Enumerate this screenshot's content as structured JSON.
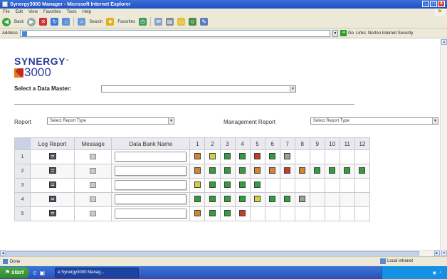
{
  "window": {
    "title": "Synergy3000 Manager - Microsoft Internet Explorer",
    "controls": [
      "_",
      "□",
      "X"
    ]
  },
  "menu": [
    "File",
    "Edit",
    "View",
    "Favorites",
    "Tools",
    "Help"
  ],
  "toolbar": {
    "back": "Back",
    "search": "Search",
    "favorites": "Favorites"
  },
  "address": {
    "label": "Address",
    "url": "",
    "go": "Go",
    "links": "Links",
    "extra": "Norton Internet Security"
  },
  "logo": {
    "word": "SYNERGY",
    "tm": "™",
    "number": "3000"
  },
  "data_master": {
    "label": "Select a Data Master:",
    "value": ""
  },
  "report": {
    "label": "Report",
    "value": "Select Report Type"
  },
  "management_report": {
    "label": "Management Report",
    "value": "Select Report Type"
  },
  "grid": {
    "headers": [
      "Log Report",
      "Message",
      "Data Bank Name"
    ],
    "day_headers": [
      "1",
      "2",
      "3",
      "4",
      "5",
      "6",
      "7",
      "8",
      "9",
      "10",
      "11",
      "12"
    ],
    "rows": [
      {
        "index": "1",
        "bank": "",
        "cells": [
          "amber",
          "yellow",
          "green",
          "green",
          "red",
          "green",
          "grey",
          "",
          "",
          "",
          "",
          ""
        ]
      },
      {
        "index": "2",
        "bank": "",
        "cells": [
          "amber",
          "green",
          "green",
          "green",
          "amber",
          "amber",
          "red",
          "amber",
          "green",
          "green",
          "green",
          "green"
        ]
      },
      {
        "index": "3",
        "bank": "",
        "cells": [
          "yellow",
          "green",
          "green",
          "green",
          "green",
          "",
          "",
          "",
          "",
          "",
          "",
          ""
        ]
      },
      {
        "index": "4",
        "bank": "",
        "cells": [
          "green",
          "green",
          "green",
          "green",
          "yellow",
          "green",
          "green",
          "grey",
          "",
          "",
          "",
          ""
        ]
      },
      {
        "index": "5",
        "bank": "",
        "cells": [
          "amber",
          "green",
          "green",
          "red",
          "",
          "",
          "",
          "",
          "",
          "",
          "",
          ""
        ]
      }
    ]
  },
  "colors": {
    "green": "#2f9e3f",
    "amber": "#d9822b",
    "red": "#c93a2e",
    "yellow": "#cfd23a",
    "grey": "#9aa29a",
    "brand_blue": "#2d3a9a",
    "brand_orange": "#e57a1a"
  },
  "statusbar": {
    "left": "Done",
    "zone": "Local intranet"
  },
  "taskbar": {
    "start": "start",
    "task": "Synergy3000 Manag...",
    "time": ""
  }
}
